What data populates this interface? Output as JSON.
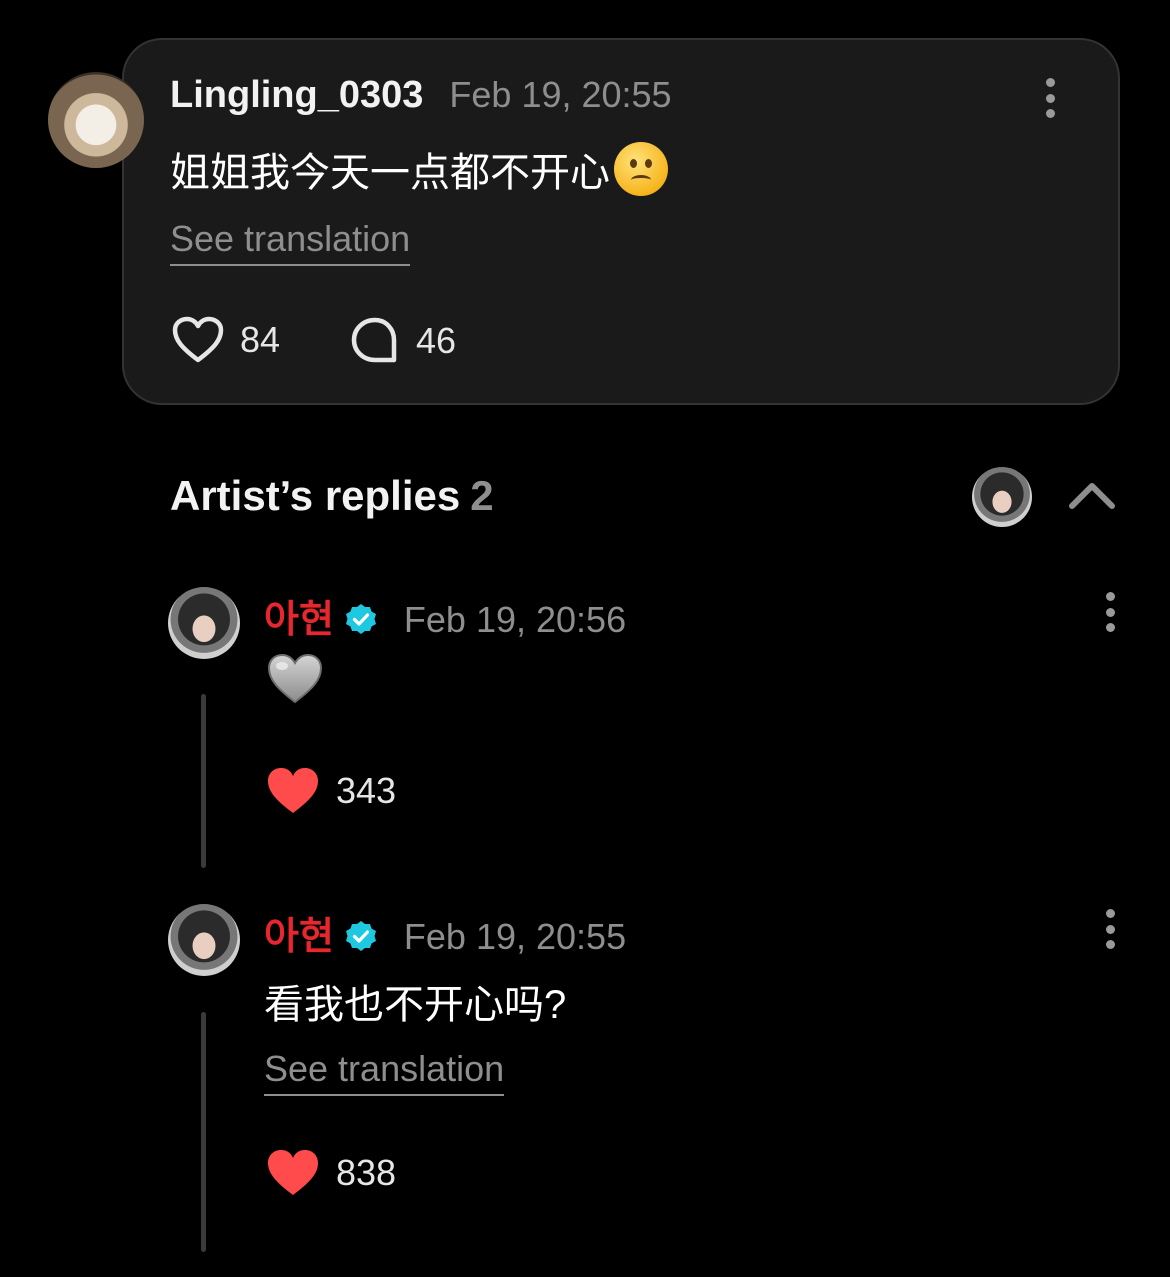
{
  "comment": {
    "username": "Lingling_0303",
    "timestamp": "Feb 19, 20:55",
    "text": "姐姐我今天一点都不开心",
    "emoji": "sad-face-emoji",
    "see_translation": "See translation",
    "likes": "84",
    "comments": "46"
  },
  "replies_section": {
    "title": "Artist’s replies",
    "count": "2"
  },
  "replies": [
    {
      "name": "아현",
      "timestamp": "Feb 19, 20:56",
      "emoji": "grey-heart-emoji",
      "likes": "343"
    },
    {
      "name": "아현",
      "timestamp": "Feb 19, 20:55",
      "text": "看我也不开心吗?",
      "see_translation": "See translation",
      "likes": "838"
    }
  ],
  "colors": {
    "background": "#000000",
    "card": "#1a1a1a",
    "artist_name": "#e8262d",
    "verified_badge": "#1ec8e0",
    "liked_heart": "#ff4b4b",
    "muted_text": "#8e8e8e"
  }
}
